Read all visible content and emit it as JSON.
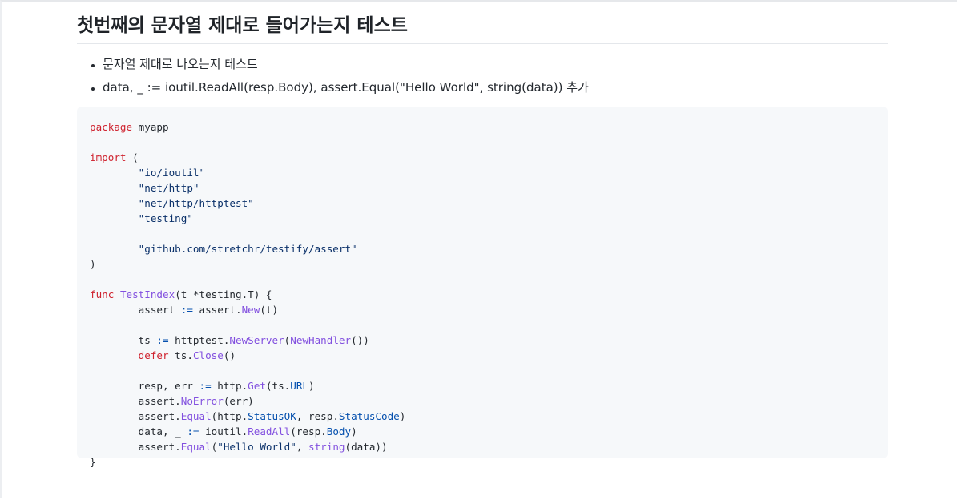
{
  "section": {
    "title": "첫번째의 문자열 제대로 들어가는지 테스트"
  },
  "notes": [
    "문자열 제대로 나오는지 테스트",
    "data, _ := ioutil.ReadAll(resp.Body), assert.Equal(\"Hello World\", string(data)) 추가"
  ],
  "code": {
    "language": "go",
    "lines": [
      [
        {
          "t": "kw",
          "v": "package"
        },
        {
          "t": "plain",
          "v": " myapp"
        }
      ],
      [],
      [
        {
          "t": "kw",
          "v": "import"
        },
        {
          "t": "plain",
          "v": " ("
        }
      ],
      [
        {
          "t": "plain",
          "v": "\t"
        },
        {
          "t": "str",
          "v": "\"io/ioutil\""
        }
      ],
      [
        {
          "t": "plain",
          "v": "\t"
        },
        {
          "t": "str",
          "v": "\"net/http\""
        }
      ],
      [
        {
          "t": "plain",
          "v": "\t"
        },
        {
          "t": "str",
          "v": "\"net/http/httptest\""
        }
      ],
      [
        {
          "t": "plain",
          "v": "\t"
        },
        {
          "t": "str",
          "v": "\"testing\""
        }
      ],
      [],
      [
        {
          "t": "plain",
          "v": "\t"
        },
        {
          "t": "str",
          "v": "\"github.com/stretchr/testify/assert\""
        }
      ],
      [
        {
          "t": "plain",
          "v": ")"
        }
      ],
      [],
      [
        {
          "t": "kw",
          "v": "func"
        },
        {
          "t": "plain",
          "v": " "
        },
        {
          "t": "fn",
          "v": "TestIndex"
        },
        {
          "t": "plain",
          "v": "(t *testing.T) {"
        }
      ],
      [
        {
          "t": "plain",
          "v": "\tassert "
        },
        {
          "t": "op",
          "v": ":="
        },
        {
          "t": "plain",
          "v": " assert."
        },
        {
          "t": "fn",
          "v": "New"
        },
        {
          "t": "plain",
          "v": "(t)"
        }
      ],
      [],
      [
        {
          "t": "plain",
          "v": "\tts "
        },
        {
          "t": "op",
          "v": ":="
        },
        {
          "t": "plain",
          "v": " httptest."
        },
        {
          "t": "fn",
          "v": "NewServer"
        },
        {
          "t": "plain",
          "v": "("
        },
        {
          "t": "fn",
          "v": "NewHandler"
        },
        {
          "t": "plain",
          "v": "())"
        }
      ],
      [
        {
          "t": "plain",
          "v": "\t"
        },
        {
          "t": "kw",
          "v": "defer"
        },
        {
          "t": "plain",
          "v": " ts."
        },
        {
          "t": "fn",
          "v": "Close"
        },
        {
          "t": "plain",
          "v": "()"
        }
      ],
      [],
      [
        {
          "t": "plain",
          "v": "\tresp, err "
        },
        {
          "t": "op",
          "v": ":="
        },
        {
          "t": "plain",
          "v": " http."
        },
        {
          "t": "fn",
          "v": "Get"
        },
        {
          "t": "plain",
          "v": "(ts."
        },
        {
          "t": "prop",
          "v": "URL"
        },
        {
          "t": "plain",
          "v": ")"
        }
      ],
      [
        {
          "t": "plain",
          "v": "\tassert."
        },
        {
          "t": "fn",
          "v": "NoError"
        },
        {
          "t": "plain",
          "v": "(err)"
        }
      ],
      [
        {
          "t": "plain",
          "v": "\tassert."
        },
        {
          "t": "fn",
          "v": "Equal"
        },
        {
          "t": "plain",
          "v": "(http."
        },
        {
          "t": "prop",
          "v": "StatusOK"
        },
        {
          "t": "plain",
          "v": ", resp."
        },
        {
          "t": "prop",
          "v": "StatusCode"
        },
        {
          "t": "plain",
          "v": ")"
        }
      ],
      [
        {
          "t": "plain",
          "v": "\tdata, _ "
        },
        {
          "t": "op",
          "v": ":="
        },
        {
          "t": "plain",
          "v": " ioutil."
        },
        {
          "t": "fn",
          "v": "ReadAll"
        },
        {
          "t": "plain",
          "v": "(resp."
        },
        {
          "t": "prop",
          "v": "Body"
        },
        {
          "t": "plain",
          "v": ")"
        }
      ],
      [
        {
          "t": "plain",
          "v": "\tassert."
        },
        {
          "t": "fn",
          "v": "Equal"
        },
        {
          "t": "plain",
          "v": "("
        },
        {
          "t": "str",
          "v": "\"Hello World\""
        },
        {
          "t": "plain",
          "v": ", "
        },
        {
          "t": "fn",
          "v": "string"
        },
        {
          "t": "plain",
          "v": "(data))"
        }
      ],
      [
        {
          "t": "plain",
          "v": "}"
        }
      ]
    ]
  }
}
